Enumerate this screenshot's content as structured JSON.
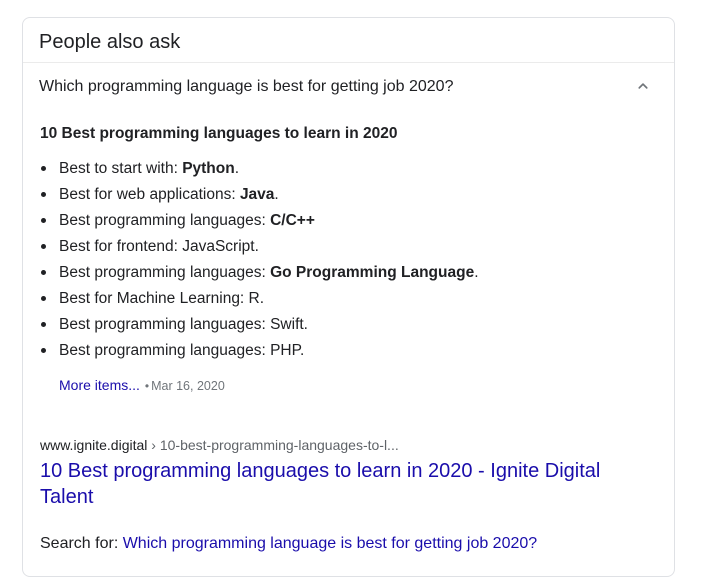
{
  "card": {
    "title": "People also ask"
  },
  "question": {
    "text": "Which programming language is best for getting job 2020?",
    "expanded": true,
    "icon": "chevron-up-icon"
  },
  "answer": {
    "heading": "10 Best programming languages to learn in 2020",
    "items": [
      {
        "prefix": "Best to start with: ",
        "bold": "Python",
        "suffix": "."
      },
      {
        "prefix": "Best for web applications: ",
        "bold": "Java",
        "suffix": "."
      },
      {
        "prefix": "Best programming languages: ",
        "bold": "C/C++",
        "suffix": ""
      },
      {
        "prefix": "Best for frontend: JavaScript.",
        "bold": "",
        "suffix": ""
      },
      {
        "prefix": "Best programming languages: ",
        "bold": "Go Programming Language",
        "suffix": "."
      },
      {
        "prefix": "Best for Machine Learning: R.",
        "bold": "",
        "suffix": ""
      },
      {
        "prefix": "Best programming languages: Swift.",
        "bold": "",
        "suffix": ""
      },
      {
        "prefix": "Best programming languages: PHP.",
        "bold": "",
        "suffix": ""
      }
    ],
    "more_label": "More items...",
    "separator": "•",
    "date": "Mar 16, 2020"
  },
  "source": {
    "domain": "www.ignite.digital",
    "path": " › 10-best-programming-languages-to-l...",
    "title": "10 Best programming languages to learn in 2020 - Ignite Digital Talent"
  },
  "search_for": {
    "label": "Search for: ",
    "query": "Which programming language is best for getting job 2020?"
  },
  "colors": {
    "link": "#1a0dab",
    "text": "#202124",
    "muted": "#70757a",
    "border": "#dfe1e5"
  }
}
